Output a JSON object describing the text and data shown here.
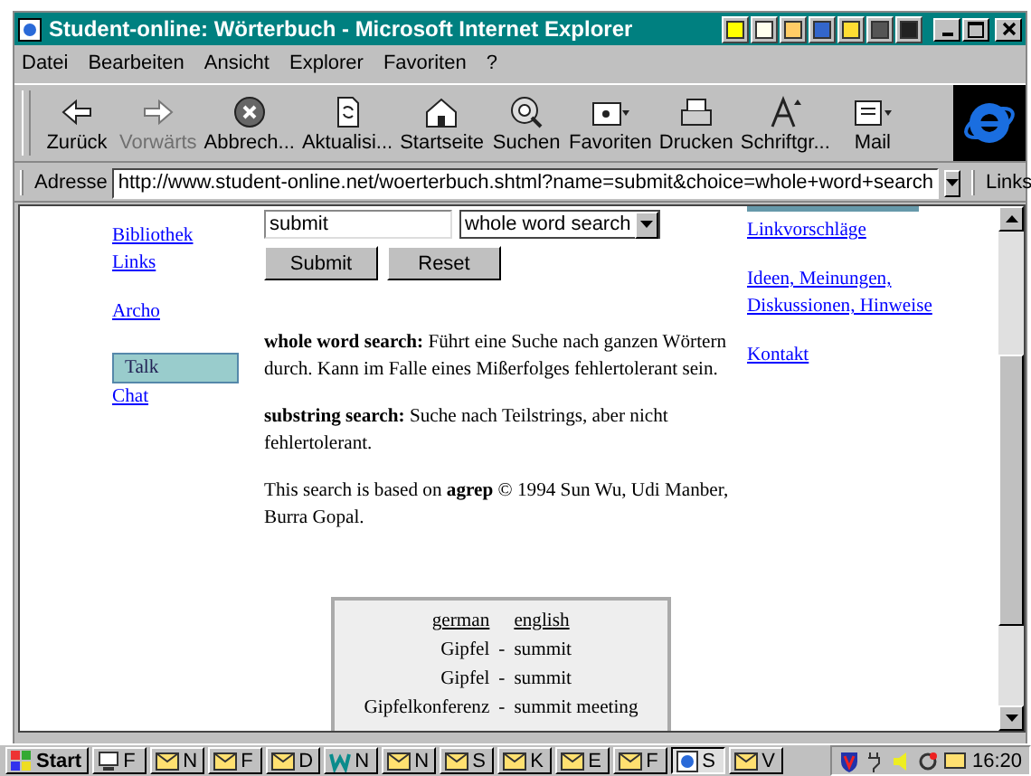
{
  "window": {
    "title": "Student-online: Wörterbuch - Microsoft Internet Explorer"
  },
  "menu": [
    "Datei",
    "Bearbeiten",
    "Ansicht",
    "Explorer",
    "Favoriten",
    "?"
  ],
  "toolbar": [
    {
      "kind": "back",
      "label": "Zurück",
      "disabled": false
    },
    {
      "kind": "forward",
      "label": "Vorwärts",
      "disabled": true
    },
    {
      "kind": "stop",
      "label": "Abbrech...",
      "disabled": false
    },
    {
      "kind": "refresh",
      "label": "Aktualisi...",
      "disabled": false
    },
    {
      "kind": "home",
      "label": "Startseite",
      "disabled": false
    },
    {
      "kind": "search",
      "label": "Suchen",
      "disabled": false
    },
    {
      "kind": "favorites",
      "label": "Favoriten",
      "disabled": false
    },
    {
      "kind": "print",
      "label": "Drucken",
      "disabled": false
    },
    {
      "kind": "font",
      "label": "Schriftgr...",
      "disabled": false
    },
    {
      "kind": "mail",
      "label": "Mail",
      "disabled": false
    }
  ],
  "address": {
    "label": "Adresse",
    "url": "http://www.student-online.net/woerterbuch.shtml?name=submit&choice=whole+word+search",
    "links": "Links"
  },
  "left_nav": [
    {
      "label": "Bibliothek",
      "selected": false
    },
    {
      "label": "Links",
      "selected": false
    },
    {
      "label": "Archo",
      "selected": false
    },
    {
      "label": "Talk",
      "selected": true
    },
    {
      "label": "Chat",
      "selected": false
    }
  ],
  "form": {
    "query": "submit",
    "mode": "whole word search",
    "buttons": [
      "Submit",
      "Reset"
    ]
  },
  "paragraphs": [
    "**whole word search:** Führt eine Suche nach ganzen Wörtern durch. Kann im Falle eines Mißerfolges fehlertolerant sein.",
    "**substring search:** Suche nach Teilstrings, aber nicht fehlertolerant.",
    "This search is based on **agrep** © 1994 Sun Wu, Udi Manber, Burra Gopal."
  ],
  "right_nav": [
    "Linkvorschläge",
    "Ideen, Meinungen, Diskussionen, Hinweise",
    "Kontakt"
  ],
  "dictionary": {
    "columns": [
      "german",
      "english"
    ],
    "rows": [
      {
        "german": "Gipfel",
        "sep": "-",
        "english": "summit"
      },
      {
        "german": "Gipfel",
        "sep": "-",
        "english": "summit"
      },
      {
        "german": "Gipfelkonferenz",
        "sep": "-",
        "english": "summit meeting"
      }
    ]
  },
  "taskbar": {
    "start": "Start",
    "items": [
      {
        "kind": "app",
        "label": "F",
        "selected": false
      },
      {
        "kind": "mail",
        "label": "N",
        "selected": false
      },
      {
        "kind": "mail",
        "label": "F",
        "selected": false
      },
      {
        "kind": "mail",
        "label": "D",
        "selected": false
      },
      {
        "kind": "word",
        "label": "N",
        "selected": false
      },
      {
        "kind": "mail",
        "label": "N",
        "selected": false
      },
      {
        "kind": "mail",
        "label": "S",
        "selected": false
      },
      {
        "kind": "mail",
        "label": "K",
        "selected": false
      },
      {
        "kind": "mail",
        "label": "E",
        "selected": false
      },
      {
        "kind": "mail",
        "label": "F",
        "selected": false
      },
      {
        "kind": "ie",
        "label": "S",
        "selected": true
      },
      {
        "kind": "mail",
        "label": "V",
        "selected": false
      }
    ],
    "clock": "16:20"
  }
}
